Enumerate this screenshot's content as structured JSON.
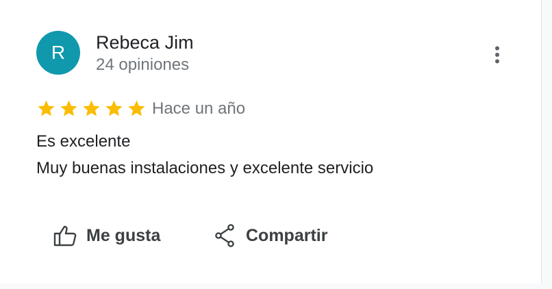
{
  "review": {
    "author_initial": "R",
    "author_name": "Rebeca Jim",
    "author_reviews": "24 opiniones",
    "rating": 5,
    "time": "Hace un año",
    "title": "Es excelente",
    "text": "Muy buenas instalaciones y excelente servicio"
  },
  "actions": {
    "like_label": "Me gusta",
    "share_label": "Compartir"
  },
  "colors": {
    "avatar": "#1098ad",
    "star": "#fbbc04",
    "muted_text": "#70757a"
  },
  "icons": {
    "more": "more-vert-icon",
    "like": "thumb-up-icon",
    "share": "share-icon",
    "star": "star-icon"
  }
}
